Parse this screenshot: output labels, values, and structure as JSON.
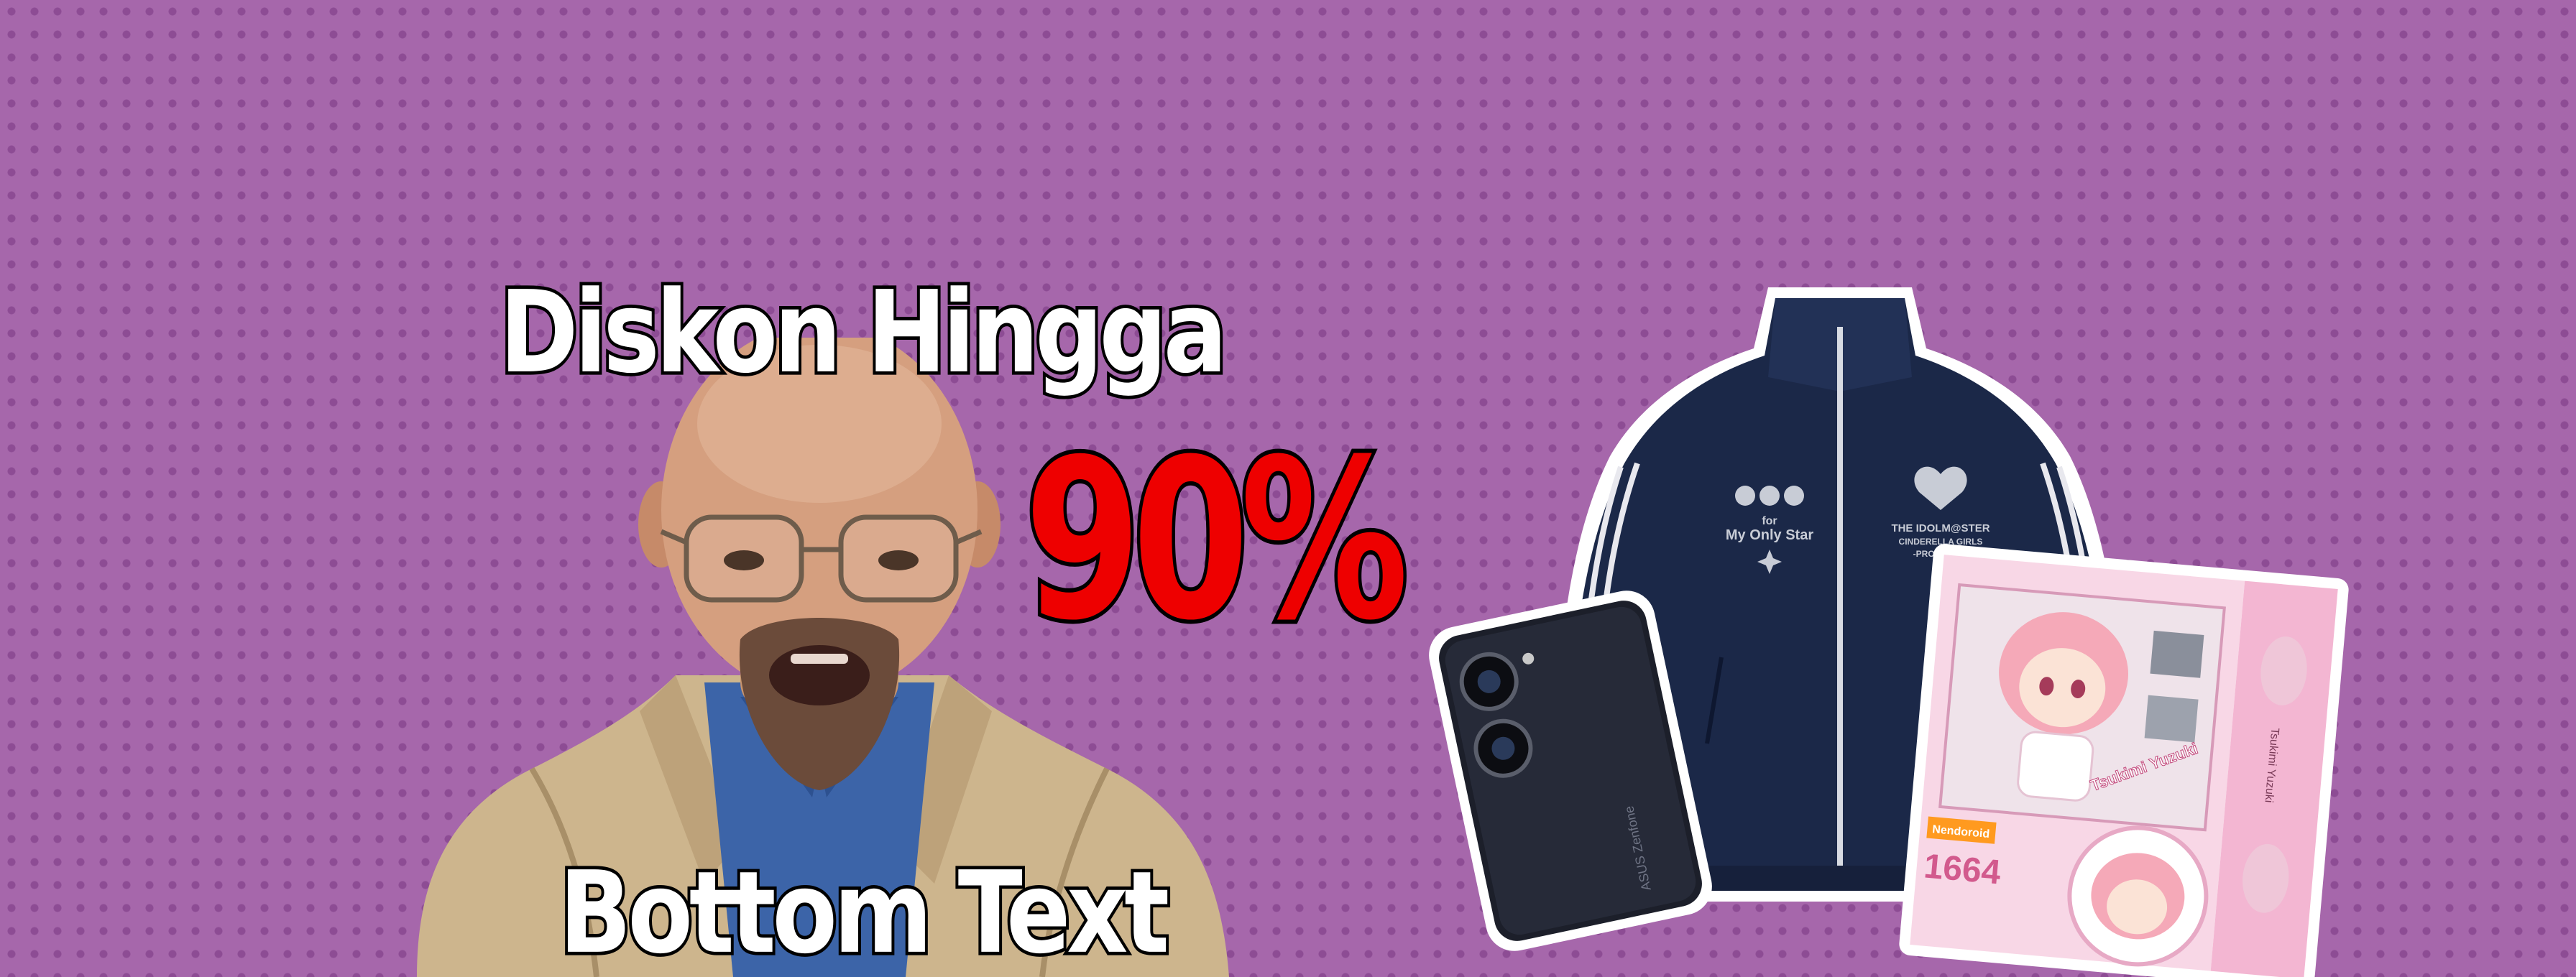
{
  "banner": {
    "headline": "Diskon Hingga",
    "discount": "90%",
    "bottom_text": "Bottom Text"
  },
  "jacket": {
    "left_print_line1": "for",
    "left_print_line2": "My Only Star",
    "right_print_line1": "THE IDOLM@STER",
    "right_print_line2": "CINDERELLA GIRLS",
    "right_print_line3": "-PRODUCER-"
  },
  "phone": {
    "brand": "ASUS Zenfone"
  },
  "figure_box": {
    "series_label": "Nendoroid",
    "character_name": "Tsukimi Yuzuki",
    "product_number": "1664",
    "side_label": "Tsukimi Yuzuki"
  },
  "colors": {
    "background": "#a667ab",
    "discount": "#ee0000",
    "jacket": "#1b2848",
    "box_pink": "#f3b6d2"
  }
}
